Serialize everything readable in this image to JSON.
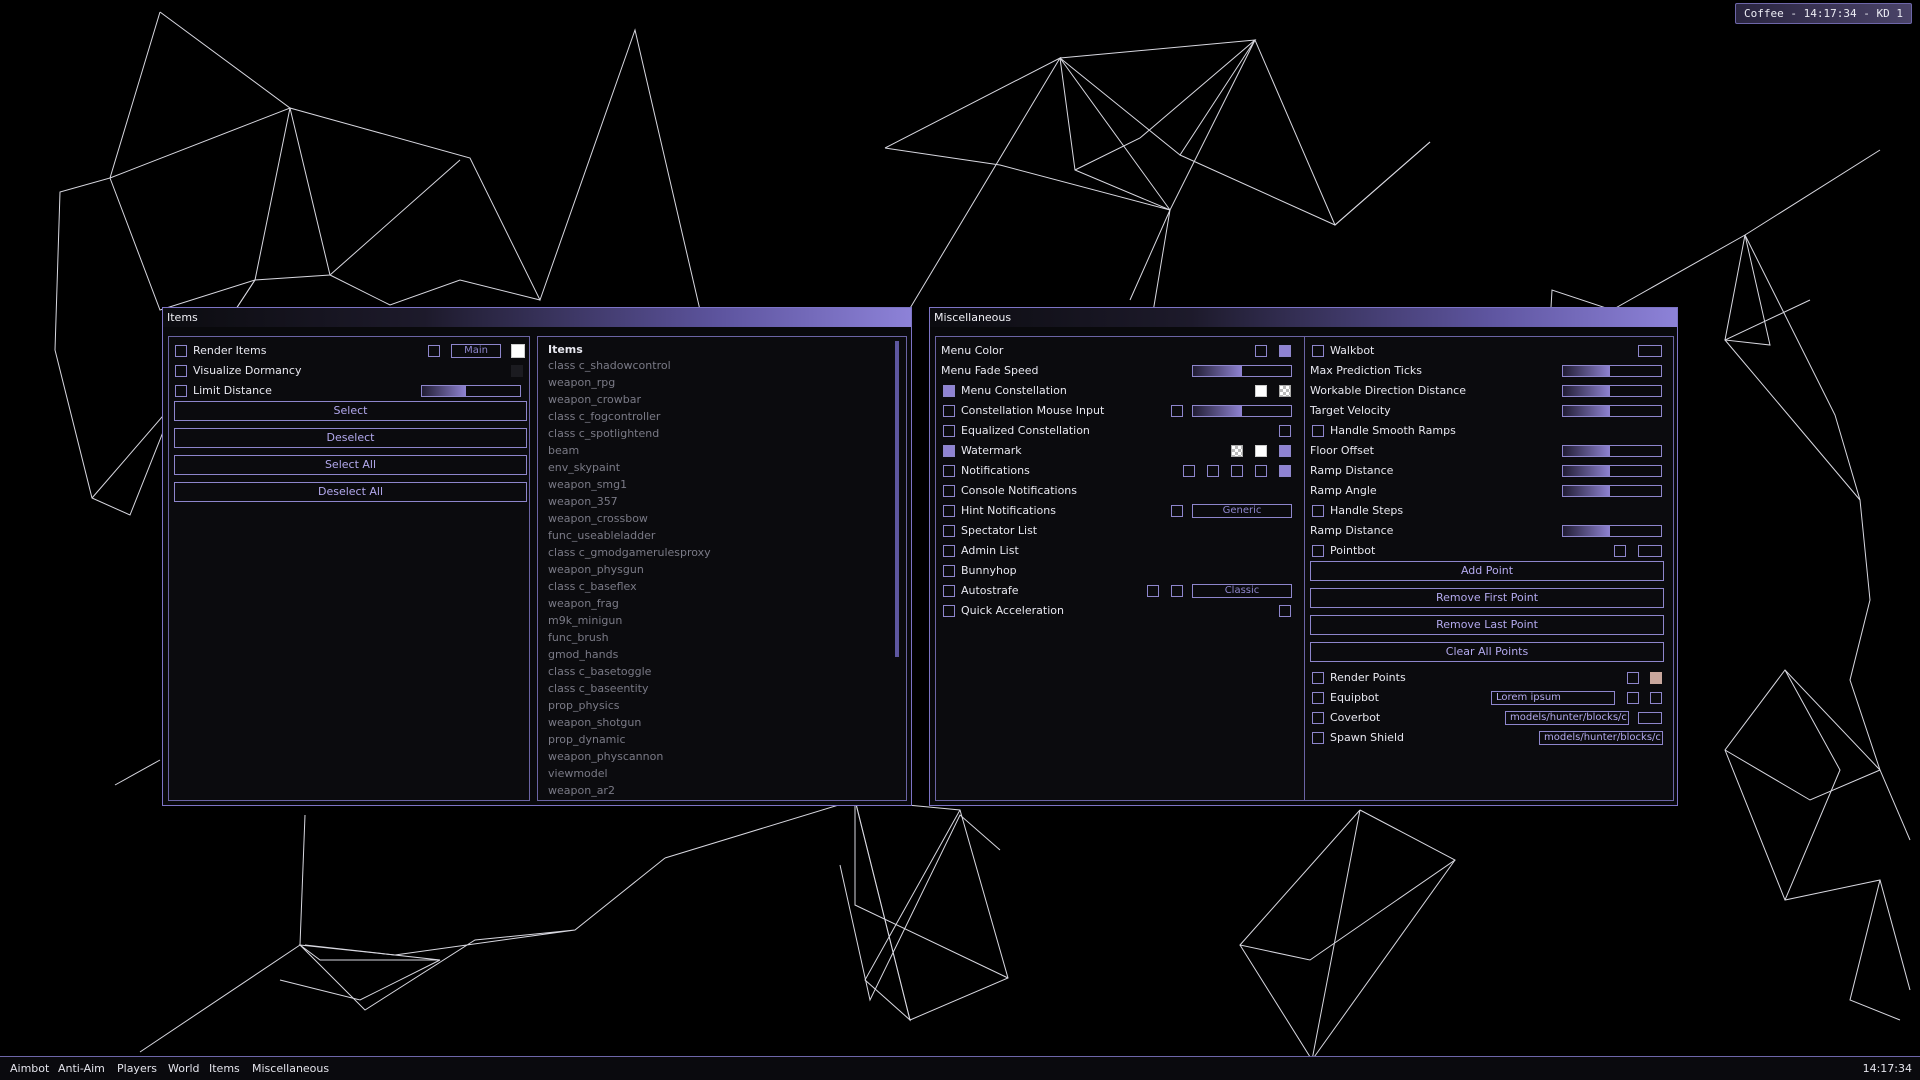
{
  "watermark": "Coffee - 14:17:34 - KD 1",
  "accent_color": "#8f83d2",
  "items_window": {
    "title": "Items",
    "options": [
      {
        "label": "Render Items",
        "checked": false
      },
      {
        "label": "Visualize Dormancy",
        "checked": false
      },
      {
        "label": "Limit Distance",
        "checked": false
      }
    ],
    "main_dropdown": "Main",
    "limit_distance_fill": 0.45,
    "buttons": [
      "Select",
      "Deselect",
      "Select All",
      "Deselect All"
    ],
    "list_header": "Items",
    "list": [
      "class c_shadowcontrol",
      "weapon_rpg",
      "weapon_crowbar",
      "class c_fogcontroller",
      "class c_spotlightend",
      "beam",
      "env_skypaint",
      "weapon_smg1",
      "weapon_357",
      "weapon_crossbow",
      "func_useableladder",
      "class c_gmodgamerulesproxy",
      "weapon_physgun",
      "class c_baseflex",
      "weapon_frag",
      "m9k_minigun",
      "func_brush",
      "gmod_hands",
      "class c_basetoggle",
      "class c_baseentity",
      "prop_physics",
      "weapon_shotgun",
      "prop_dynamic",
      "weapon_physcannon",
      "viewmodel",
      "weapon_ar2"
    ]
  },
  "misc_window": {
    "title": "Miscellaneous",
    "left": {
      "menu_color": "Menu Color",
      "menu_fade_speed": "Menu Fade Speed",
      "menu_fade_fill": 0.5,
      "checks": [
        {
          "label": "Menu Constellation",
          "checked": true
        },
        {
          "label": "Constellation Mouse Input",
          "checked": false
        },
        {
          "label": "Equalized Constellation",
          "checked": false
        },
        {
          "label": "Watermark",
          "checked": true
        },
        {
          "label": "Notifications",
          "checked": false
        },
        {
          "label": "Console Notifications",
          "checked": false
        },
        {
          "label": "Hint Notifications",
          "checked": false
        },
        {
          "label": "Spectator List",
          "checked": false
        },
        {
          "label": "Admin List",
          "checked": false
        },
        {
          "label": "Bunnyhop",
          "checked": false
        },
        {
          "label": "Autostrafe",
          "checked": false
        },
        {
          "label": "Quick Acceleration",
          "checked": false
        }
      ],
      "constellation_mouse_fill": 0.5,
      "hint_dropdown": "Generic",
      "autostrafe_dropdown": "Classic"
    },
    "right": {
      "walkbot": "Walkbot",
      "sliders": [
        {
          "label": "Max Prediction Ticks",
          "fill": 0.48
        },
        {
          "label": "Workable Direction Distance",
          "fill": 0.48
        },
        {
          "label": "Target Velocity",
          "fill": 0.48
        }
      ],
      "handle_smooth_ramps": "Handle Smooth Ramps",
      "sliders2": [
        {
          "label": "Floor Offset",
          "fill": 0.48
        },
        {
          "label": "Ramp Distance",
          "fill": 0.48
        },
        {
          "label": "Ramp Angle",
          "fill": 0.48
        }
      ],
      "handle_steps": "Handle Steps",
      "ramp_distance2": {
        "label": "Ramp Distance",
        "fill": 0.48
      },
      "pointbot": "Pointbot",
      "buttons": [
        "Add Point",
        "Remove First Point",
        "Remove Last Point",
        "Clear All Points"
      ],
      "render_points": "Render Points",
      "equipbot": "Equipbot",
      "equipbot_value": "Lorem ipsum",
      "coverbot": "Coverbot",
      "coverbot_value": "models/hunter/blocks/c",
      "spawn_shield": "Spawn Shield",
      "spawn_shield_value": "models/hunter/blocks/c"
    }
  },
  "taskbar": {
    "items": [
      "Aimbot",
      "Anti-Aim",
      "Players",
      "World",
      "Items",
      "Miscellaneous"
    ],
    "clock": "14:17:34"
  }
}
